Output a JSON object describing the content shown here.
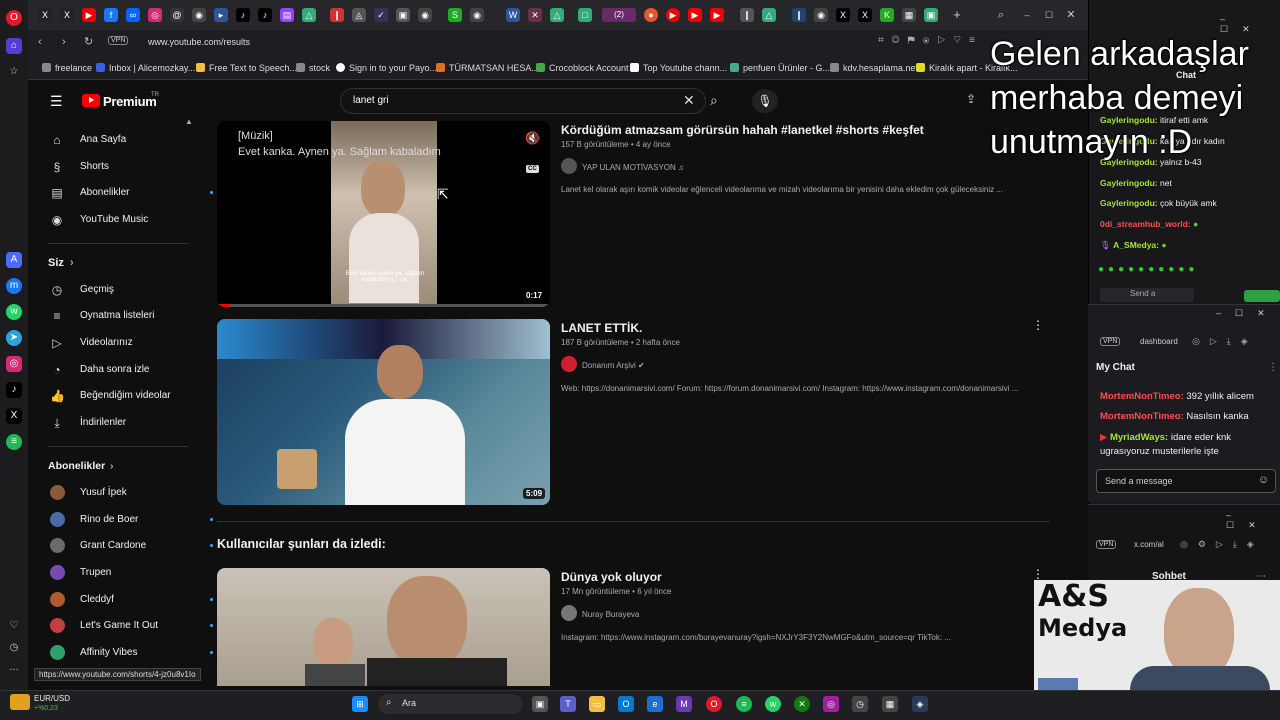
{
  "browser": {
    "url": "www.youtube.com/results",
    "vpn_label": "VPN",
    "bookmarks": [
      "freelance",
      "Inbox | Alicemozkay...",
      "Free Text to Speech...",
      "stock",
      "Sign in to your Payo...",
      "TÜRMATSAN HESA...",
      "Crocoblock Account",
      "Top Youtube chann...",
      "penfuen Ürünler - G...",
      "kdv.hesaplama.net",
      "Kiralık apart - Kiralık..."
    ],
    "tab_badge": "(2)",
    "status_url": "https://www.youtube.com/shorts/4-jz0u8v1Io"
  },
  "youtube": {
    "logo_text": "Premium",
    "logo_region": "TR",
    "search_query": "lanet gri",
    "sidebar": {
      "main": [
        "Ana Sayfa",
        "Shorts",
        "Abonelikler",
        "YouTube Music"
      ],
      "you_header": "Siz",
      "you_items": [
        "Geçmiş",
        "Oynatma listeleri",
        "Videolarınız",
        "Daha sonra izle",
        "Beğendiğim videolar",
        "İndirilenler"
      ],
      "subs_header": "Abonelikler",
      "subscriptions": [
        "Yusuf İpek",
        "Rino de Boer",
        "Grant Cardone",
        "Trupen",
        "Cleddyf",
        "Let's Game It Out",
        "Affinity Vibes"
      ]
    },
    "results": [
      {
        "title": "Kördüğüm atmazsam görürsün hahah #lanetkel #shorts #keşfet",
        "views": "157 B görüntüleme",
        "age": "4 ay önce",
        "channel": "YAP ULAN MOTİVASYON",
        "description": "Lanet kel olarak aşırı komik videolar eğlenceli videolarıma ve mizah videolarıma bir yenisini daha ekledim çok güleceksiniz ...",
        "duration": "0:17",
        "caption_top": "[Müzik]",
        "caption_line": "Evet kanka. Aynen ya. Sağlam kabaladım",
        "burned_sub": "Evet kanka aynen ya, sağlam kafaladım g... uy."
      },
      {
        "title": "LANET ETTİK.",
        "views": "187 B görüntüleme",
        "age": "2 hafta önce",
        "channel": "Donanım Arşivi",
        "description": "Web: https://donanimarsivi.com/ Forum: https://forum.donanimarsivi.com/ Instagram: https://www.instagram.com/donanimarsivi ...",
        "duration": "5:09"
      }
    ],
    "section_header": "Kullanıcılar şunları da izledi:",
    "related": [
      {
        "title": "Dünya yok oluyor",
        "views": "17 Mn görüntüleme",
        "age": "6 yıl önce",
        "channel": "Nuray Burayeva",
        "description": "Instagram: https://www.instagram.com/burayevanuray?igsh=NXJrY3F3Y2NwMGFo&utm_source=qr TikTok: ..."
      }
    ]
  },
  "stream": {
    "overlay": "Gelen arkadaşlar merhaba demeyi unutmayın :D",
    "chat_title": "Chat",
    "chat_lines": [
      {
        "user": "Gayleringodu:",
        "msg": "itiraf etti amk"
      },
      {
        "user": "Gayleringodu:",
        "msg": "kaç ya ndır kadın"
      },
      {
        "user": "Gayleringodu:",
        "msg": "yalnız b-43"
      },
      {
        "user": "Gayleringodu:",
        "msg": "net"
      },
      {
        "user": "Gayleringodu:",
        "msg": "çok büyük amk"
      },
      {
        "user": "0di_streamhub_world:",
        "msg": ""
      },
      {
        "user": "A_SMedya:",
        "msg": ""
      }
    ],
    "send_placeholder": "Send a",
    "dashboard_url": "dashboard",
    "my_chat_title": "My Chat",
    "my_chat_lines": [
      {
        "user": "MortemNonTimeo:",
        "msg": "392 yıllık alicem"
      },
      {
        "user": "MortemNonTimeo:",
        "msg": "Nasılsın kanka"
      },
      {
        "user": "MyriadWays:",
        "msg": "idare eder knk ugrasıyoruz musterilerle işte"
      }
    ],
    "my_chat_placeholder": "Send a message",
    "x_url": "x.com/al",
    "sohbet": "Sohbet",
    "brand_line1": "A&S",
    "brand_line2": "Medya"
  },
  "taskbar": {
    "ticker_name": "EUR/USD",
    "ticker_change": "+%0,23",
    "search_label": "Ara"
  },
  "colors": {
    "yt_red": "#ff0000",
    "accent_blue": "#3ea6ff"
  }
}
